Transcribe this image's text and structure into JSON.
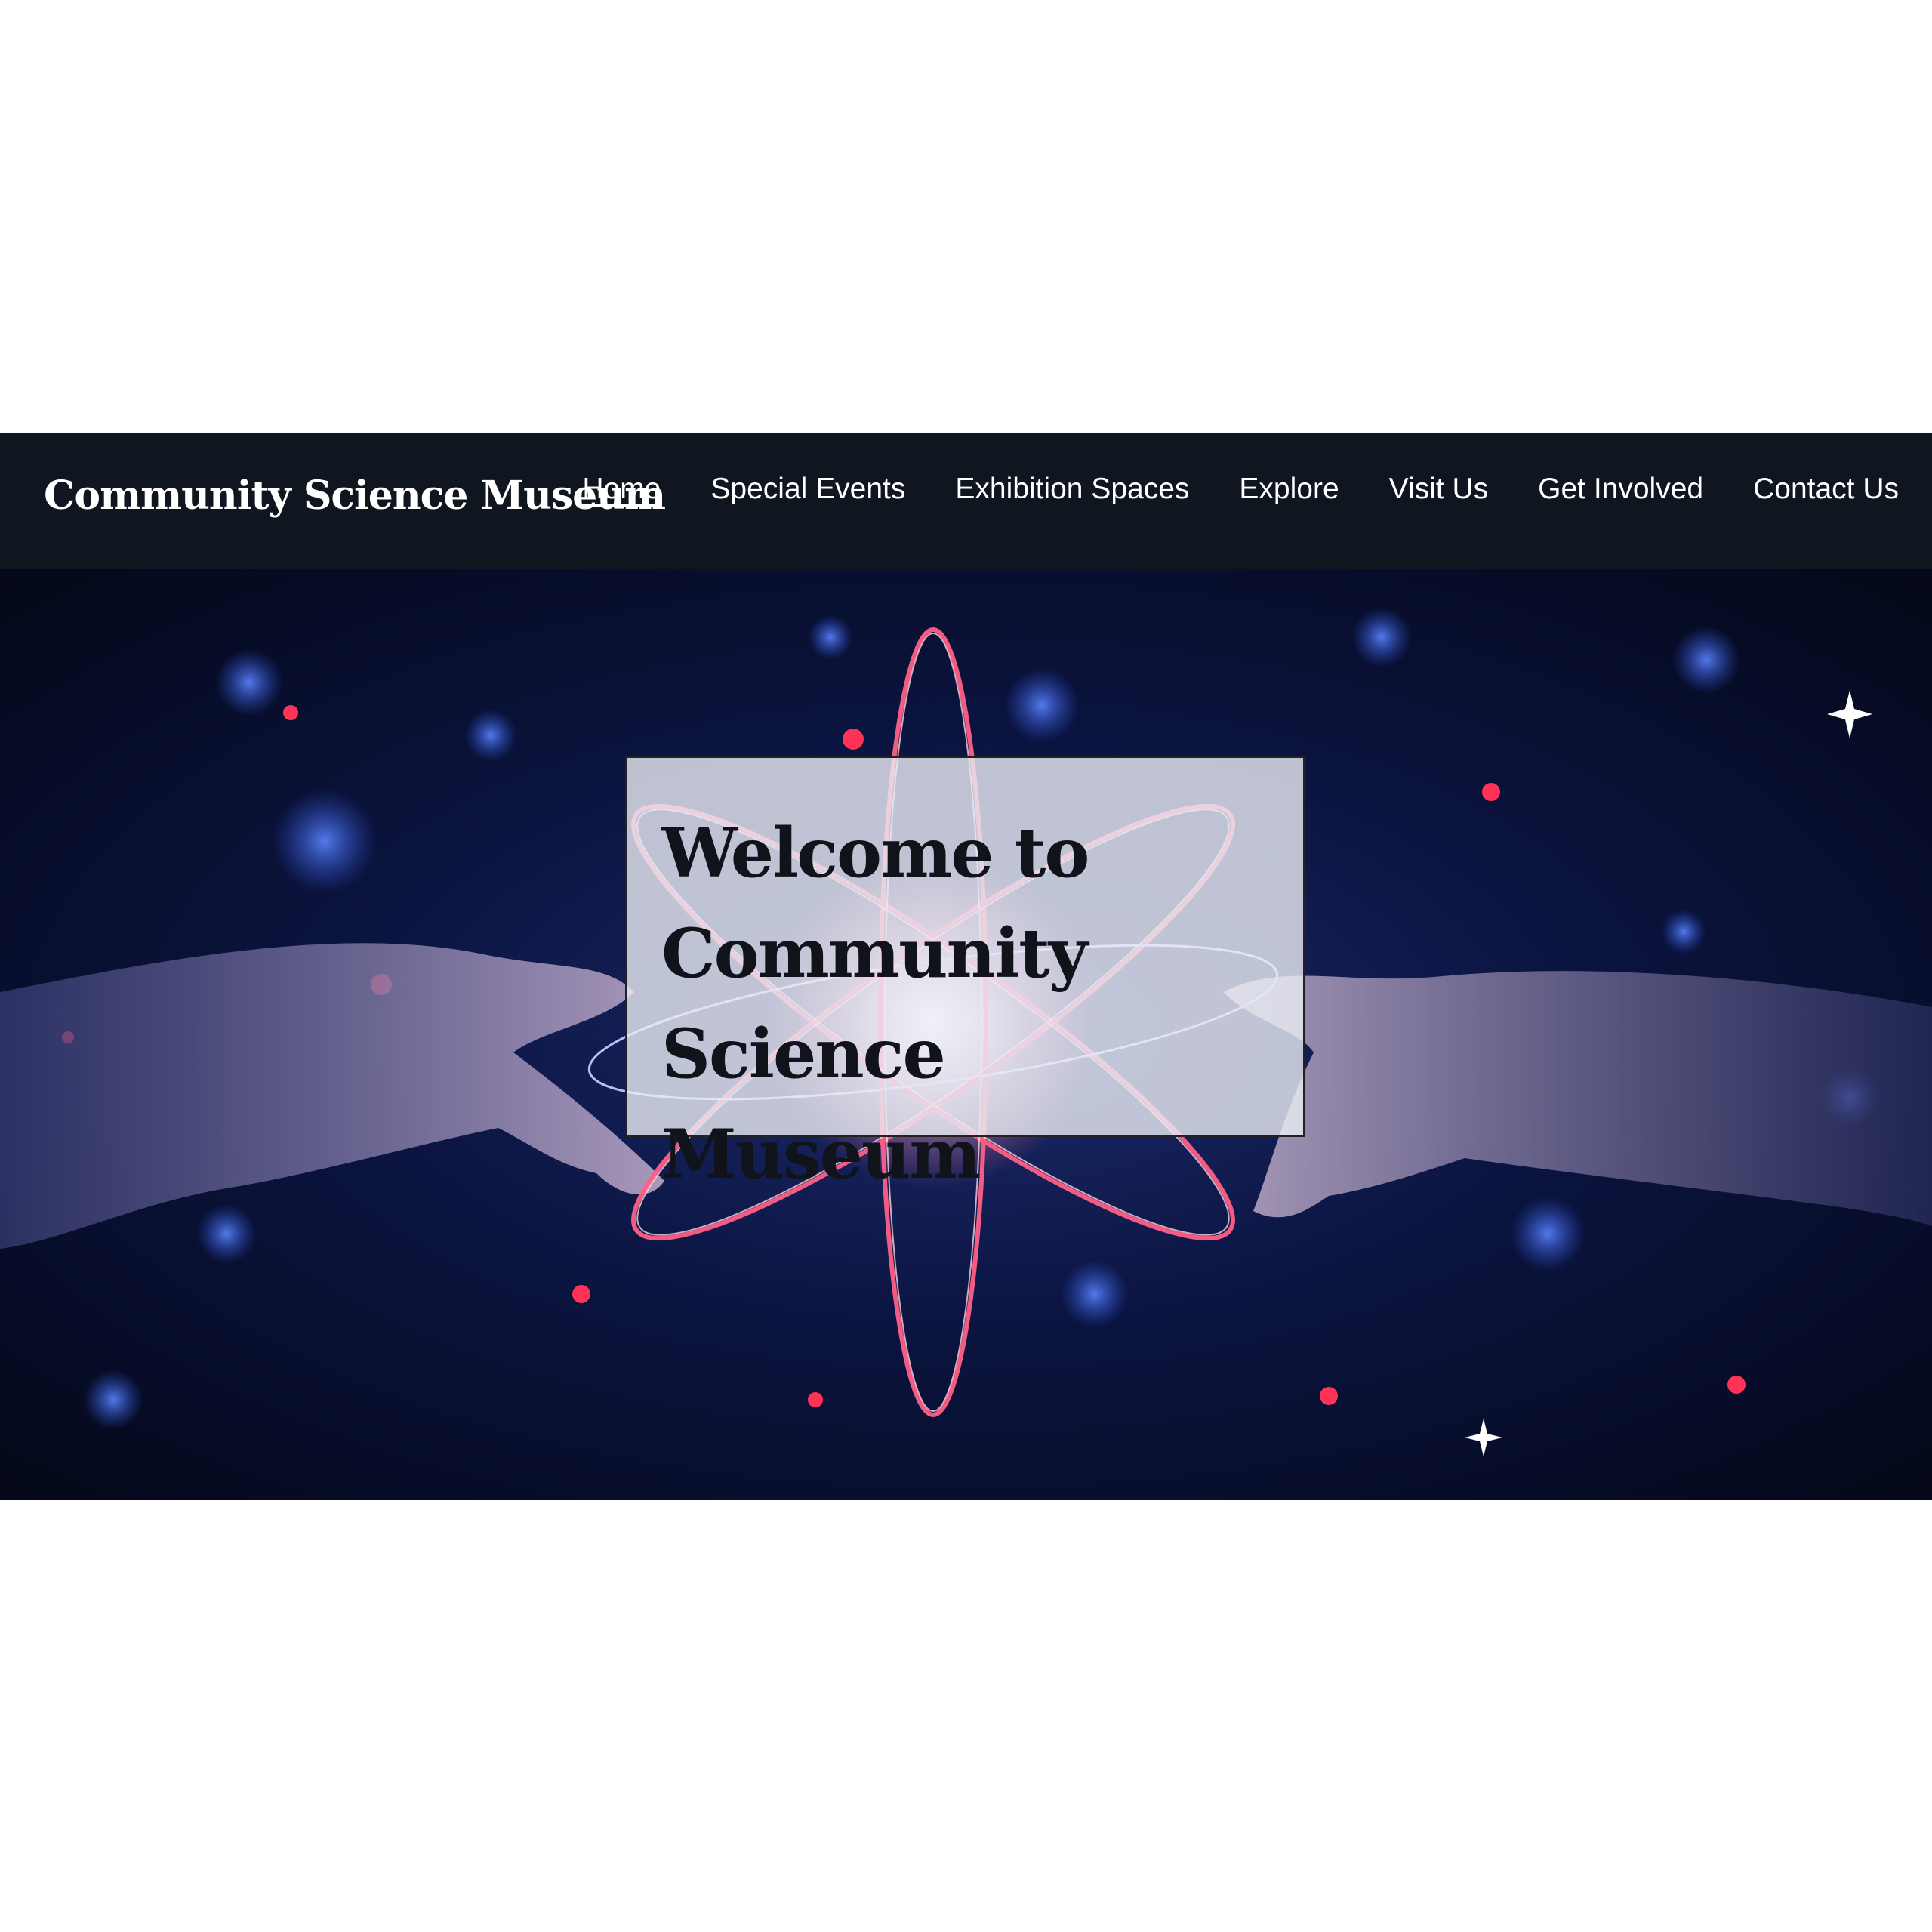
{
  "header": {
    "brand": "Community Science Museum"
  },
  "nav": {
    "items": [
      {
        "label": "Home",
        "active": true
      },
      {
        "label": "Special Events"
      },
      {
        "label": "Exhibition Spaces"
      },
      {
        "label": "Explore"
      },
      {
        "label": "Visit Us"
      },
      {
        "label": "Get Involved"
      },
      {
        "label": "Contact Us"
      }
    ]
  },
  "hero": {
    "heading": "Welcome to Community Science Museum",
    "image_icon": "atom-hands-image"
  },
  "colors": {
    "navbar_bg": "#10161f",
    "hero_bg": "#0b1440",
    "welcome_box_bg": "#ebeef5"
  }
}
